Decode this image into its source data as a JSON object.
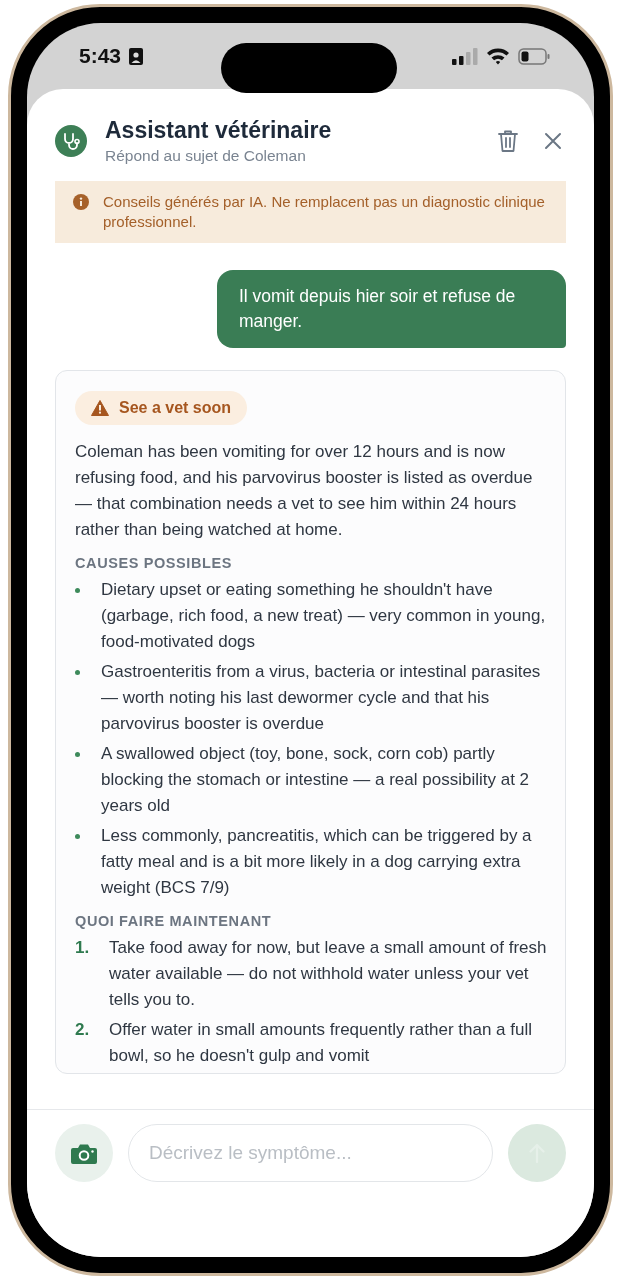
{
  "status_bar": {
    "time": "5:43"
  },
  "header": {
    "title": "Assistant vétérinaire",
    "subtitle": "Répond au sujet de Coleman"
  },
  "disclaimer": "Conseils générés par IA. Ne remplacent pas un diagnostic clinique professionnel.",
  "messages": [
    {
      "kind": "user",
      "text": "Il vomit depuis hier soir et refuse de manger."
    },
    {
      "kind": "assistant",
      "urgency": "See a vet soon",
      "summary": "Coleman has been vomiting for over 12 hours and is now refusing food, and his parvovirus booster is listed as overdue — that combination needs a vet to see him within 24 hours rather than being watched at home.",
      "sections": [
        {
          "kind": "bullets",
          "title": "CAUSES POSSIBLES",
          "items": [
            {
              "text": "Dietary upset or eating something he shouldn't have (garbage, rich food, a new treat) — very common in young, food-motivated dogs"
            },
            {
              "text": "Gastroenteritis from a virus, bacteria or intestinal parasites — worth noting his last dewormer cycle and that his parvovirus booster is overdue"
            },
            {
              "text": "A swallowed object (toy, bone, sock, corn cob) partly blocking the stomach or intestine — a real possibility at 2 years old"
            },
            {
              "text": "Less commonly, pancreatitis, which can be triggered by a fatty meal and is a bit more likely in a dog carrying extra weight (BCS 7/9)"
            }
          ]
        },
        {
          "kind": "numbered",
          "title": "QUOI FAIRE MAINTENANT",
          "items": [
            {
              "number": "1.",
              "text": "Take food away for now, but leave a small amount of fresh water available — do not withhold water unless your vet tells you to."
            },
            {
              "number": "2.",
              "text": "Offer water in small amounts frequently rather than a full bowl, so he doesn't gulp and vomit"
            }
          ]
        }
      ]
    }
  ],
  "composer": {
    "placeholder": "Décrivez le symptôme...",
    "send_disabled": true
  }
}
